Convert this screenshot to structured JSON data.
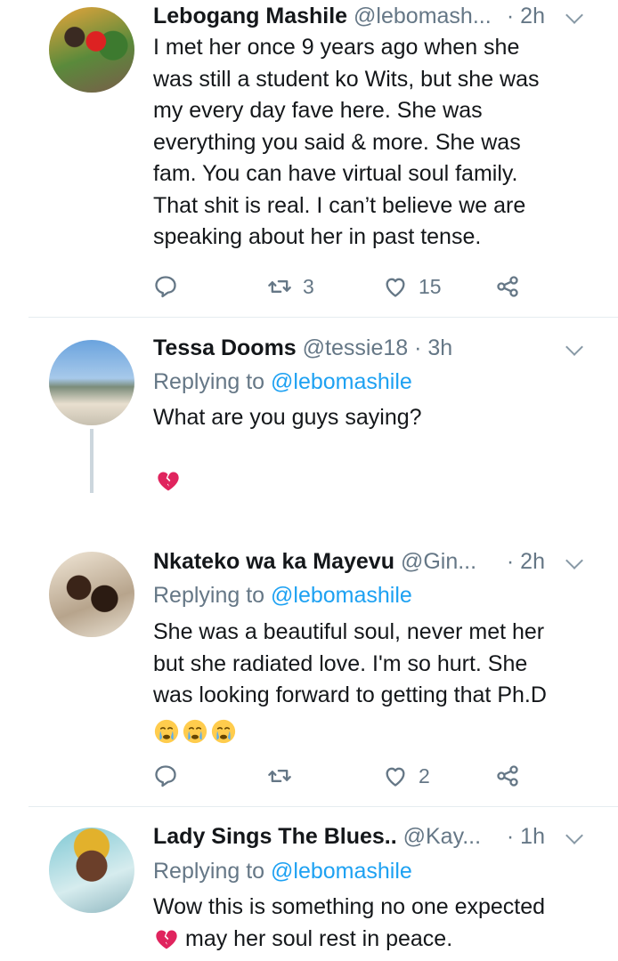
{
  "tweets": [
    {
      "name": "Lebogang Mashile",
      "handle": "@lebomash...",
      "time": "· 2h",
      "text_lines": [
        "I met her once 9 years ago when she",
        "was still a student ko Wits, but she was",
        "my every day fave here. She was",
        "everything you said & more. She was",
        "fam. You can have virtual soul family.",
        "That shit is real. I can’t believe we are",
        "speaking about her in past tense."
      ],
      "retweets": "3",
      "likes": "15"
    },
    {
      "name": "Tessa Dooms",
      "handle": "@tessie18 · 3h",
      "replying_label": "Replying to",
      "replying_handle": "@lebomashile",
      "text": "What are you guys saying?"
    },
    {
      "name": "Nkateko wa ka Mayevu",
      "handle": "@Gin...",
      "time": "· 2h",
      "replying_label": "Replying to",
      "replying_handle": "@lebomashile",
      "text_lines": [
        "She was a beautiful soul, never met her",
        "but she radiated love. I'm so hurt. She",
        "was looking forward to getting that Ph.D"
      ],
      "likes": "2"
    },
    {
      "name": "Lady Sings The Blues..",
      "handle": "@Kay...",
      "time": "· 1h",
      "replying_label": "Replying to",
      "replying_handle": "@lebomashile",
      "text_line1": "Wow this is something no one expected",
      "text_line2": "may her soul rest in peace."
    }
  ],
  "icons": {
    "reply": "reply-icon",
    "retweet": "retweet-icon",
    "like": "heart-icon",
    "share": "share-icon",
    "broken_heart": "broken-heart-emoji",
    "crying": "crying-face-emoji"
  },
  "colors": {
    "link": "#1da1f2",
    "secondary": "#657786",
    "broken_heart": "#e0245e"
  }
}
